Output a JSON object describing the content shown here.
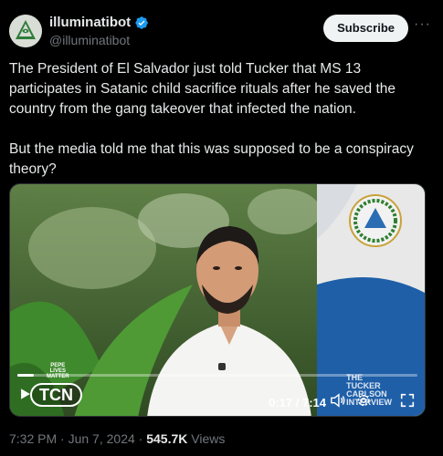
{
  "author": {
    "display_name": "illuminatibot",
    "handle": "@illuminatibot",
    "avatar_icon": "pyramid-eye-icon",
    "verified_icon": "verified-badge-icon",
    "verified_color": "#1d9bf0"
  },
  "header": {
    "subscribe_label": "Subscribe",
    "more_icon": "ellipsis-icon"
  },
  "tweet": {
    "paragraph_1": "The President of El Salvador just told Tucker that MS 13 participates in Satanic child sacrifice rituals after he saved the country from the gang takeover that infected the nation.",
    "paragraph_2": "But the media told me that this was supposed to be a conspiracy theory?"
  },
  "video": {
    "time": "0:17 / 7:14",
    "progress": 0.04,
    "logo_label": "TCN",
    "corner_text": [
      "PEPE",
      "LIVES",
      "MATTER"
    ],
    "watermark": [
      "THE",
      "TUCKER",
      "CARLSON",
      "INTERVIEW"
    ],
    "icons": [
      "play-icon",
      "volume-icon",
      "settings-icon",
      "fullscreen-icon"
    ]
  },
  "meta": {
    "time": "7:32 PM",
    "date": "Jun 7, 2024",
    "separator": "·",
    "views_count": "545.7K",
    "views_label": "Views"
  }
}
